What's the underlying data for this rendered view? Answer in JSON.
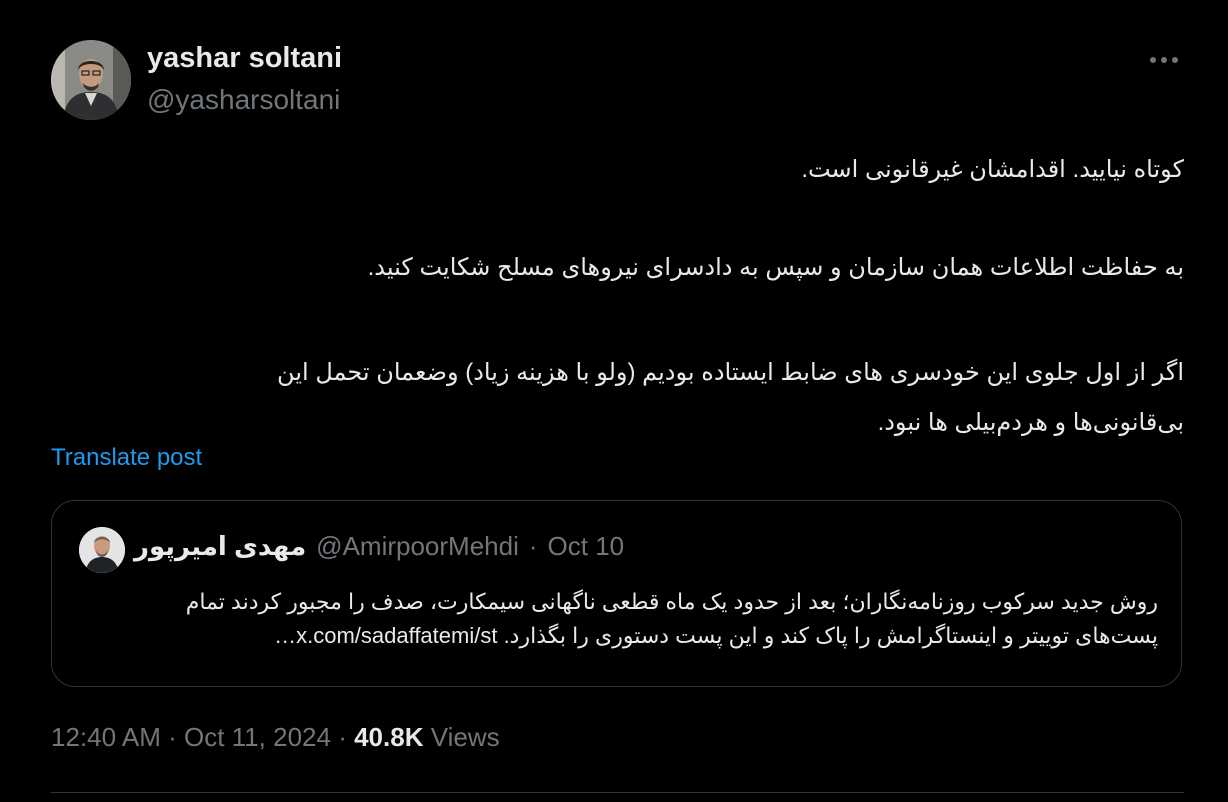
{
  "author": {
    "name": "yashar soltani",
    "handle": "@yasharsoltani"
  },
  "tweet": {
    "paragraphs": [
      "کوتاه نیایید. اقدامشان غیرقانونی است.",
      "به حفاظت اطلاعات همان سازمان و سپس به دادسرای نیروهای مسلح شکایت کنید.",
      "اگر از اول جلوی این خودسری های ضابط ایستاده بودیم (ولو با هزینه زیاد) وضعمان تحمل این",
      "بی‌قانونی‌ها و هردم‌بیلی ها نبود."
    ],
    "translate_label": "Translate post"
  },
  "quote": {
    "name": "مهدی امیرپور",
    "handle": "@AmirpoorMehdi",
    "separator": "·",
    "date": "Oct 10",
    "lines": [
      "روش جدید سرکوب روزنامه‌نگاران؛ بعد از حدود یک ماه قطعی ناگهانی سیمکارت، صدف را مجبور کردند تمام",
      "پست‌های توییتر و اینستاگرامش را پاک کند و این پست دستوری را بگذارد. x.com/sadaffatemi/st…"
    ]
  },
  "meta": {
    "time": "12:40 AM",
    "separator": "·",
    "date": "Oct 11, 2024",
    "views_count": "40.8K",
    "views_label": "Views"
  },
  "icons": {
    "more": "more-horizontal-icon"
  },
  "colors": {
    "background": "#000000",
    "text": "#e7e9ea",
    "muted": "#71767b",
    "link": "#1d9bf0",
    "border": "#2f3336"
  }
}
